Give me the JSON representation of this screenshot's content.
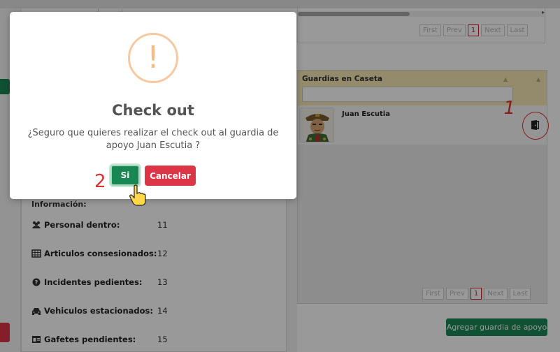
{
  "top_table": {
    "pager": [
      "First",
      "Prev",
      "1",
      "Next",
      "Last"
    ]
  },
  "guards_panel": {
    "title": "Guardias en Caseta",
    "filter_value": "",
    "guard_name": "Juan Escutia",
    "pager": [
      "First",
      "Prev",
      "1",
      "Next",
      "Last"
    ],
    "checkout_icon": "door-exit-icon"
  },
  "annotations": {
    "one": "1",
    "two": "2"
  },
  "add_button_label": "Agregar guardia de apoyo",
  "info": {
    "heading": "Información:",
    "rows": [
      {
        "icon": "users-icon",
        "label": "Personal dentro:",
        "value": "11"
      },
      {
        "icon": "table-icon",
        "label": "Articulos consesionados:",
        "value": "12"
      },
      {
        "icon": "question-circle-icon",
        "label": "Incidentes pedientes:",
        "value": "13"
      },
      {
        "icon": "car-icon",
        "label": "Vehiculos estacionados:",
        "value": "14"
      },
      {
        "icon": "id-card-icon",
        "label": "Gafetes pendientes:",
        "value": "15"
      }
    ]
  },
  "modal": {
    "icon_glyph": "!",
    "title": "Check out",
    "message": "¿Seguro que quieres realizar el check out al guardia de apoyo Juan Escutia ?",
    "confirm_label": "Si",
    "cancel_label": "Cancelar"
  },
  "colors": {
    "primary_green": "#198754",
    "danger_red": "#dc3545",
    "warning_orange": "#f8bb86",
    "header_yellow": "#f7e8b6",
    "annotation_red": "#e03030"
  }
}
